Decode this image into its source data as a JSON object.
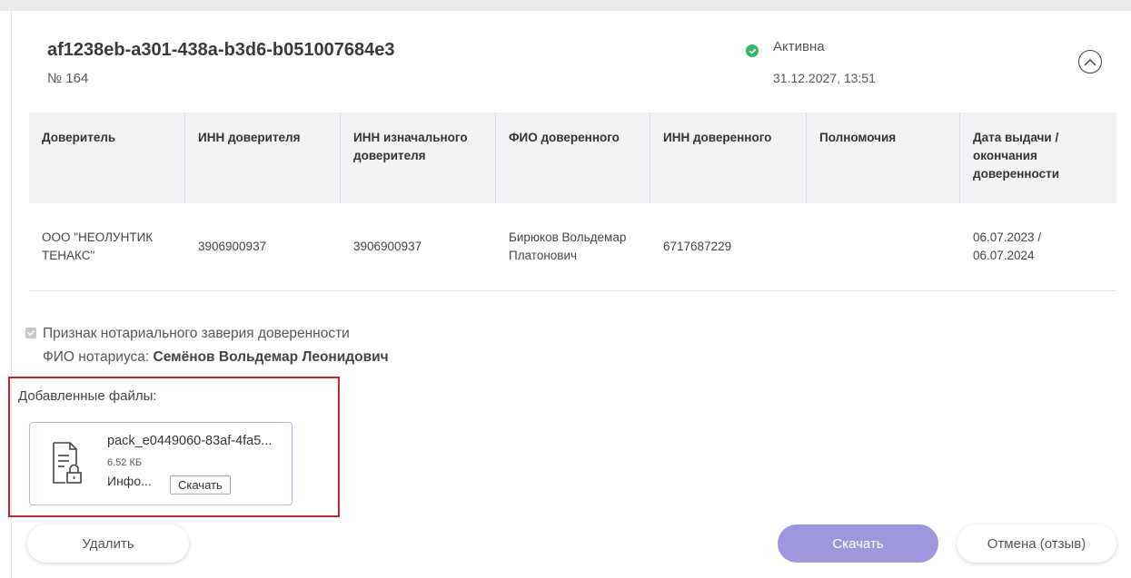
{
  "header": {
    "doc_id": "af1238eb-a301-438a-b3d6-b051007684e3",
    "doc_number": "№ 164",
    "status": "Активна",
    "status_date": "31.12.2027, 13:51",
    "status_color": "#33b86b"
  },
  "table": {
    "columns": [
      "Доверитель",
      "ИНН доверителя",
      "ИНН изначального доверителя",
      "ФИО доверенного",
      "ИНН доверенного",
      "Полномочия",
      "Дата выдачи / окончания доверенности"
    ],
    "rows": [
      [
        "ООО \"НЕОЛУНТИК ТЕНАКС\"",
        "3906900937",
        "3906900937",
        "Бирюков Вольдемар Платонович",
        "6717687229",
        "",
        "06.07.2023 / 06.07.2024"
      ]
    ]
  },
  "notary": {
    "flag_label": "Признак нотариального заверия доверенности",
    "name_label": "ФИО нотариуса:",
    "name_value": "Семёнов Вольдемар Леонидович"
  },
  "files": {
    "title": "Добавленные файлы:",
    "items": [
      {
        "name": "pack_e0449060-83af-4fa5...",
        "size": "6.52 КБ",
        "info": "Инфо...",
        "download_label": "Скачать",
        "icon": "locked-document-icon"
      }
    ]
  },
  "actions": {
    "delete_label": "Удалить",
    "download_label": "Скачать",
    "cancel_label": "Отмена (отзыв)",
    "accent_color": "#9f97db",
    "highlight_color": "#c0262d"
  }
}
